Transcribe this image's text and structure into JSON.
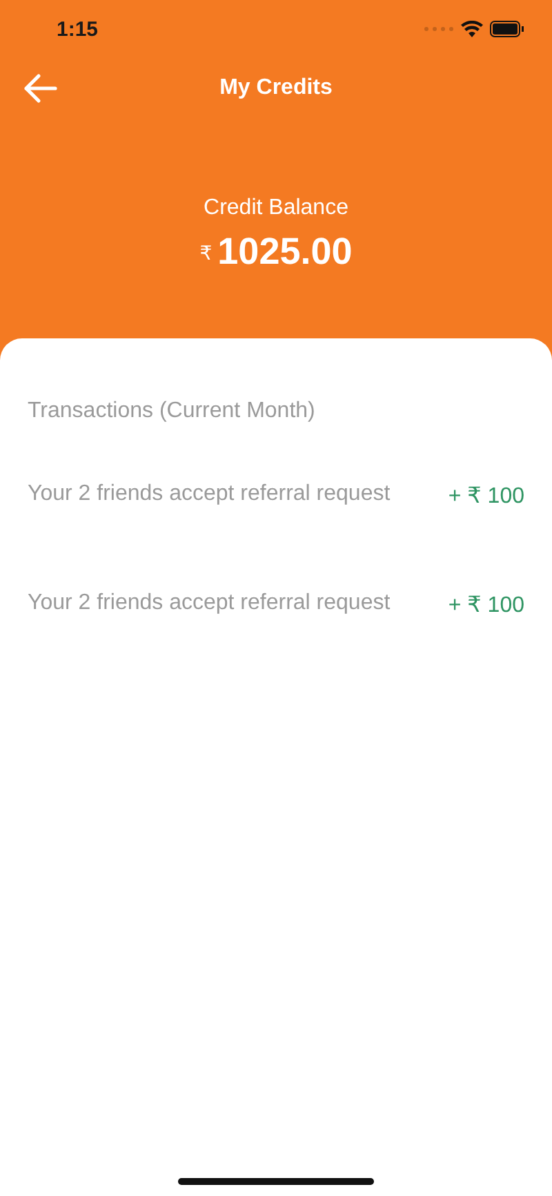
{
  "status_bar": {
    "time": "1:15"
  },
  "header": {
    "title": "My Credits"
  },
  "balance": {
    "label": "Credit Balance",
    "currency": "₹",
    "amount": "1025.00"
  },
  "transactions": {
    "title": "Transactions (Current Month)",
    "items": [
      {
        "description": "Your 2 friends accept referral request",
        "amount": "+ ₹ 100"
      },
      {
        "description": "Your 2 friends accept referral request",
        "amount": "+ ₹ 100"
      }
    ]
  }
}
